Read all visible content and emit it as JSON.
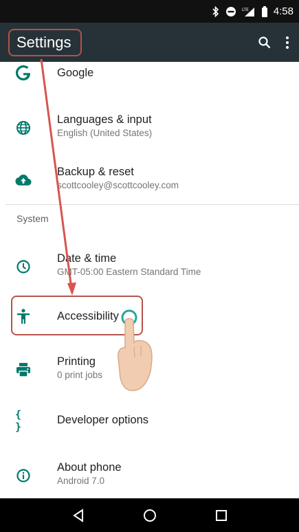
{
  "status_bar": {
    "time": "4:58",
    "icons": [
      "bluetooth-icon",
      "do-not-disturb-icon",
      "lte-signal-icon",
      "battery-icon"
    ]
  },
  "app_bar": {
    "title": "Settings",
    "actions": [
      "search-icon",
      "more-vert-icon"
    ]
  },
  "items": [
    {
      "icon": "google-icon",
      "title": "Google",
      "subtitle": ""
    },
    {
      "icon": "globe-icon",
      "title": "Languages & input",
      "subtitle": "English (United States)"
    },
    {
      "icon": "cloud-upload-icon",
      "title": "Backup & reset",
      "subtitle": "scottcooley@scottcooley.com"
    }
  ],
  "section": {
    "label": "System"
  },
  "system_items": [
    {
      "icon": "clock-icon",
      "title": "Date & time",
      "subtitle": "GMT-05:00 Eastern Standard Time"
    },
    {
      "icon": "accessibility-icon",
      "title": "Accessibility",
      "subtitle": ""
    },
    {
      "icon": "printer-icon",
      "title": "Printing",
      "subtitle": "0 print jobs"
    },
    {
      "icon": "braces-icon",
      "title": "Developer options",
      "subtitle": ""
    },
    {
      "icon": "info-icon",
      "title": "About phone",
      "subtitle": "Android 7.0"
    }
  ],
  "nav_bar": {
    "buttons": [
      "back-icon",
      "home-icon",
      "recents-icon"
    ]
  },
  "colors": {
    "accent": "#00796b",
    "app_bar": "#263238",
    "status_bar": "#111111",
    "annotation": "#b5524a"
  }
}
